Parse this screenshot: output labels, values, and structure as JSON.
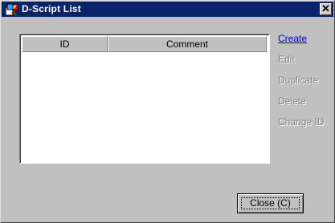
{
  "window": {
    "title": "D-Script List",
    "title_icon": "script-edit-icon",
    "close_glyph": "✕"
  },
  "list": {
    "columns": [
      "ID",
      "Comment"
    ],
    "rows": []
  },
  "actions": {
    "create": "Create",
    "edit": "Edit",
    "duplicate": "Duplicate",
    "delete": "Delete",
    "change_id": "Change ID"
  },
  "footer": {
    "close_label": "Close (C)"
  },
  "colors": {
    "titlebar": "#0a246a",
    "face": "#c0c0c0",
    "link": "#0000ee",
    "disabled_text": "#808080"
  }
}
